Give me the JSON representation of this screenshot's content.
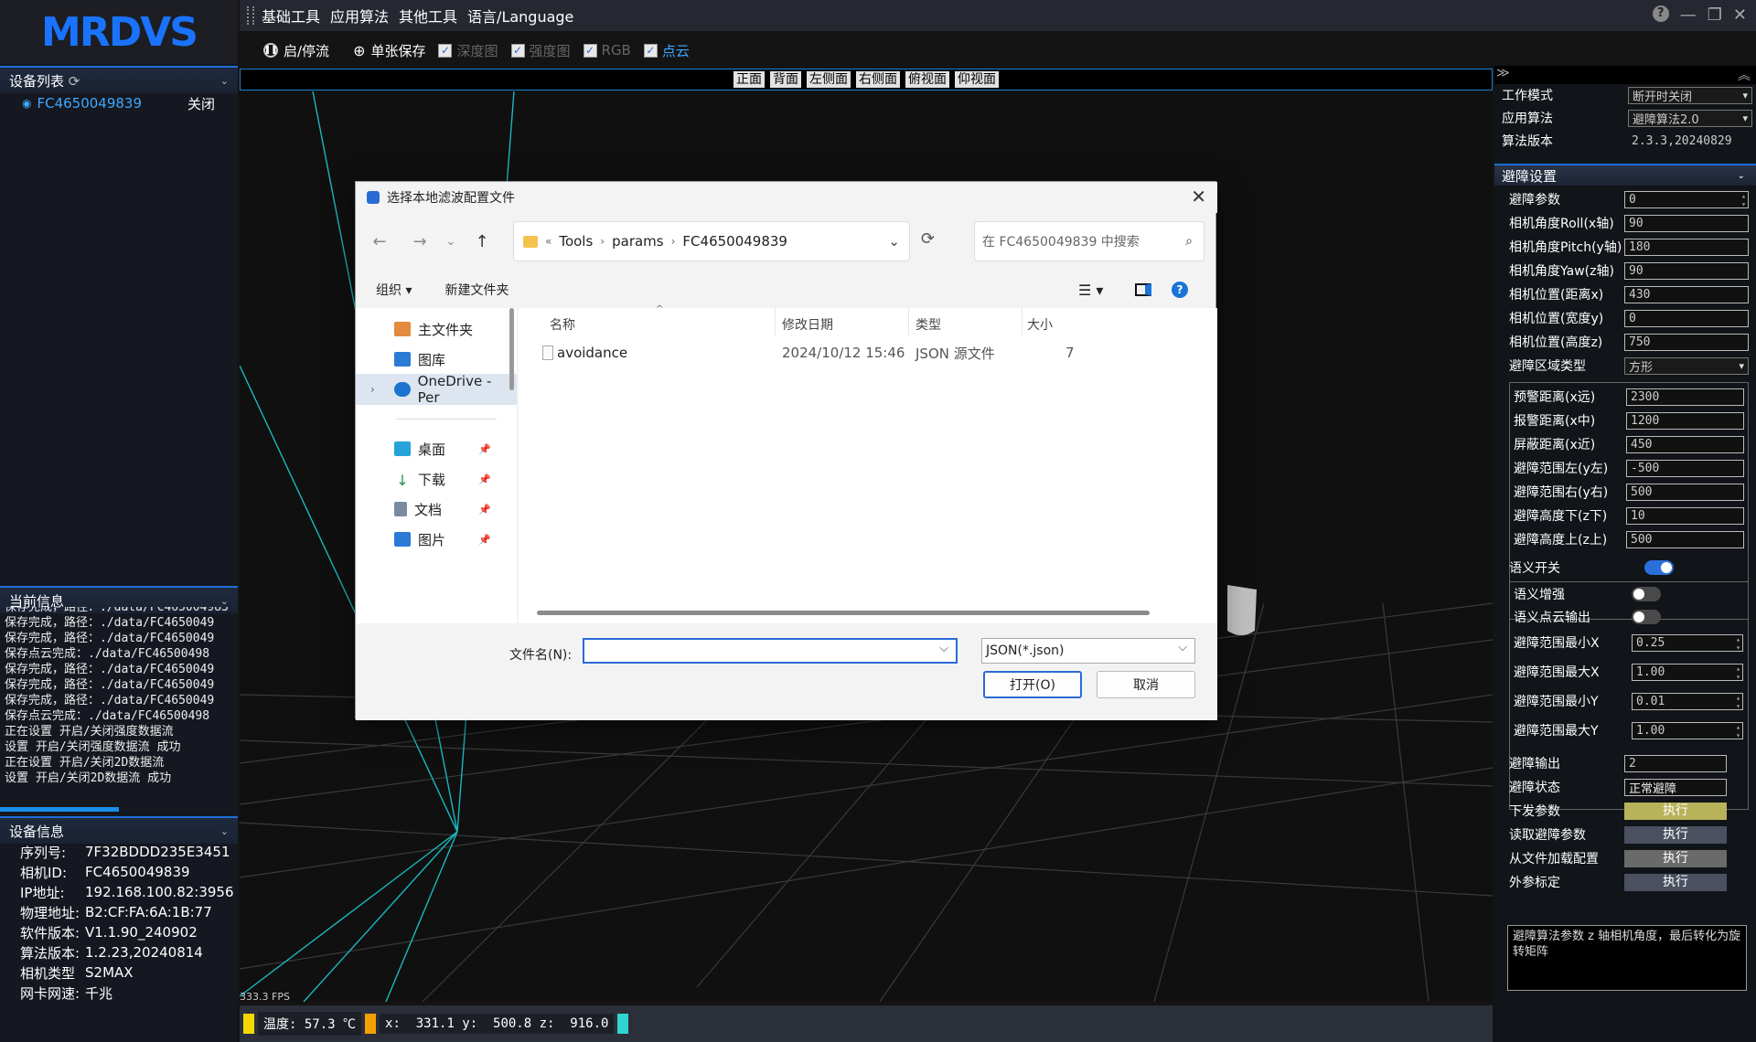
{
  "app": {
    "logo": "MRDVS"
  },
  "menu": {
    "items": [
      "基础工具",
      "应用算法",
      "其他工具",
      "语言/Language"
    ]
  },
  "window_controls": {
    "help": "?",
    "minimize": "—",
    "restore": "❐",
    "close": "✕"
  },
  "toolbar": {
    "start_stop": "启/停流",
    "single_save": "单张保存",
    "checks": [
      {
        "label": "深度图",
        "checked": true,
        "active": false
      },
      {
        "label": "强度图",
        "checked": true,
        "active": false
      },
      {
        "label": "RGB",
        "checked": true,
        "active": false
      },
      {
        "label": "点云",
        "checked": true,
        "active": true
      }
    ]
  },
  "views": [
    "正面",
    "背面",
    "左侧面",
    "右侧面",
    "俯视面",
    "仰视面"
  ],
  "left": {
    "device_list_title": "设备列表",
    "device": {
      "id": "FC4650049839",
      "status": "关闭"
    },
    "current_info_title": "当前信息",
    "log": [
      "保存完成，路径：./data/FC465004983",
      "保存完成，路径：./data/FC4650049",
      "保存完成，路径：./data/FC4650049",
      "保存点云完成：./data/FC46500498",
      "保存完成，路径：./data/FC4650049",
      "保存完成，路径：./data/FC4650049",
      "保存完成，路径：./data/FC4650049",
      "保存点云完成：./data/FC46500498",
      "正在设置 开启/关闭强度数据流",
      "设置 开启/关闭强度数据流 成功",
      "正在设置 开启/关闭2D数据流",
      "设置 开启/关闭2D数据流 成功"
    ],
    "device_info_title": "设备信息",
    "device_info": [
      {
        "k": "序列号:",
        "v": "7F32BDDD235E3451"
      },
      {
        "k": "相机ID:",
        "v": "FC4650049839"
      },
      {
        "k": "IP地址:",
        "v": "192.168.100.82:3956"
      },
      {
        "k": "物理地址:",
        "v": "B2:CF:FA:6A:1B:77"
      },
      {
        "k": "软件版本:",
        "v": "V1.1.90_240902"
      },
      {
        "k": "算法版本:",
        "v": "1.2.23,20240814"
      },
      {
        "k": "相机类型",
        "v": "S2MAX"
      },
      {
        "k": "网卡网速:",
        "v": "千兆"
      }
    ]
  },
  "viewport": {
    "fps": "333.3 FPS"
  },
  "status": {
    "temp": "温度: 57.3 ℃",
    "coords": "x:  331.1 y:  500.8 z:  916.0",
    "colors": {
      "temp_swatch": "#f5d800",
      "coord_swatch": "#f5a000",
      "end_swatch": "#2fd5d0"
    }
  },
  "right": {
    "work_mode_label": "工作模式",
    "work_mode": "断开时关闭",
    "app_algo_label": "应用算法",
    "app_algo": "避障算法2.0",
    "algo_version_label": "算法版本",
    "algo_version": "2.3.3,20240829",
    "avoid_settings_title": "避障设置",
    "params": [
      {
        "label": "避障参数",
        "value": "0",
        "kind": "spin"
      },
      {
        "label": "相机角度Roll(x轴)",
        "value": "90",
        "kind": "inp"
      },
      {
        "label": "相机角度Pitch(y轴)",
        "value": "180",
        "kind": "inp"
      },
      {
        "label": "相机角度Yaw(z轴)",
        "value": "90",
        "kind": "inp"
      },
      {
        "label": "相机位置(距离x)",
        "value": "430",
        "kind": "inp"
      },
      {
        "label": "相机位置(宽度y)",
        "value": "0",
        "kind": "inp"
      },
      {
        "label": "相机位置(高度z)",
        "value": "750",
        "kind": "inp"
      },
      {
        "label": "避障区域类型",
        "value": "方形",
        "kind": "dropdown"
      }
    ],
    "zone_params": [
      {
        "label": "预警距离(x远)",
        "value": "2300"
      },
      {
        "label": "报警距离(x中)",
        "value": "1200"
      },
      {
        "label": "屏蔽距离(x近)",
        "value": "450"
      },
      {
        "label": "避障范围左(y左)",
        "value": "-500"
      },
      {
        "label": "避障范围右(y右)",
        "value": "500"
      },
      {
        "label": "避障高度下(z下)",
        "value": "10"
      },
      {
        "label": "避障高度上(z上)",
        "value": "500"
      }
    ],
    "semantic_switch_label": "语义开关",
    "semantic_switch": true,
    "semantic_enhance_label": "语义增强",
    "semantic_enhance": false,
    "semantic_cloud_label": "语义点云输出",
    "semantic_cloud": false,
    "semantic_ranges": [
      {
        "label": "避障范围最小X",
        "value": "0.25"
      },
      {
        "label": "避障范围最大X",
        "value": "1.00"
      },
      {
        "label": "避障范围最小Y",
        "value": "0.01"
      },
      {
        "label": "避障范围最大Y",
        "value": "1.00"
      }
    ],
    "output_label": "避障输出",
    "output": "2",
    "state_label": "避障状态",
    "state": "正常避障",
    "actions": [
      {
        "label": "下发参数",
        "button": "执行",
        "color": "#b8b35a"
      },
      {
        "label": "读取避障参数",
        "button": "执行",
        "color": "#4a5060"
      },
      {
        "label": "从文件加载配置",
        "button": "执行",
        "color": "#6a6a6a"
      },
      {
        "label": "外参标定",
        "button": "执行",
        "color": "#4a5060"
      }
    ],
    "description": "避障算法参数 z 轴相机角度，最后转化为旋转矩阵"
  },
  "dialog": {
    "title": "选择本地滤波配置文件",
    "breadcrumb": [
      "«",
      "Tools",
      "params",
      "FC4650049839"
    ],
    "search_placeholder": "在 FC4650049839 中搜索",
    "organize": "组织 ▾",
    "new_folder": "新建文件夹",
    "sidebar": [
      {
        "label": "主文件夹",
        "icon": "home-icon",
        "pinned": false
      },
      {
        "label": "图库",
        "icon": "gallery-icon",
        "pinned": false
      },
      {
        "label": "OneDrive - Per",
        "icon": "onedrive-icon",
        "pinned": false
      },
      {
        "label": "桌面",
        "icon": "desktop-icon",
        "pinned": true
      },
      {
        "label": "下载",
        "icon": "download-icon",
        "pinned": true
      },
      {
        "label": "文档",
        "icon": "documents-icon",
        "pinned": true
      },
      {
        "label": "图片",
        "icon": "pictures-icon",
        "pinned": true
      }
    ],
    "columns": [
      "名称",
      "修改日期",
      "类型",
      "大小"
    ],
    "files": [
      {
        "name": "avoidance",
        "date": "2024/10/12 15:46",
        "type": "JSON 源文件",
        "size": "7"
      }
    ],
    "filename_label": "文件名(N):",
    "filename_value": "",
    "filter": "JSON(*.json)",
    "open": "打开(O)",
    "cancel": "取消"
  }
}
